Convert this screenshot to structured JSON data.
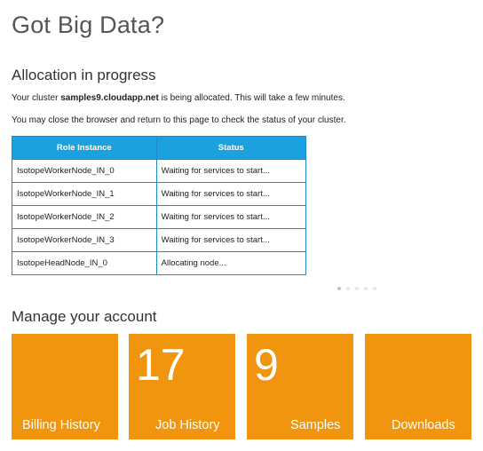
{
  "page": {
    "title": "Got Big Data?"
  },
  "allocation": {
    "title": "Allocation in progress",
    "message_prefix": "Your cluster ",
    "cluster_name": "samples9.cloudapp.net",
    "message_suffix": " is being allocated. This will take a few minutes.",
    "close_note": "You may close the browser and return to this page to check the status of your cluster."
  },
  "roles_table": {
    "headers": [
      "Role Instance",
      "Status"
    ],
    "rows": [
      {
        "role": "IsotopeWorkerNode_IN_0",
        "status": "Waiting for services to start..."
      },
      {
        "role": "IsotopeWorkerNode_IN_1",
        "status": "Waiting for services to start..."
      },
      {
        "role": "IsotopeWorkerNode_IN_2",
        "status": "Waiting for services to start..."
      },
      {
        "role": "IsotopeWorkerNode_IN_3",
        "status": "Waiting for services to start..."
      },
      {
        "role": "IsotopeHeadNode_IN_0",
        "status": "Allocating node..."
      }
    ],
    "header_color": "#1ca1e0"
  },
  "pager": {
    "dot_count": 5,
    "active_index": 0
  },
  "account": {
    "title": "Manage your account",
    "tile_color": "#f0950d",
    "tiles": [
      {
        "label": "Billing History",
        "count": ""
      },
      {
        "label": "Job History",
        "count": "17"
      },
      {
        "label": "Samples",
        "count": "9"
      },
      {
        "label": "Downloads",
        "count": ""
      }
    ]
  }
}
